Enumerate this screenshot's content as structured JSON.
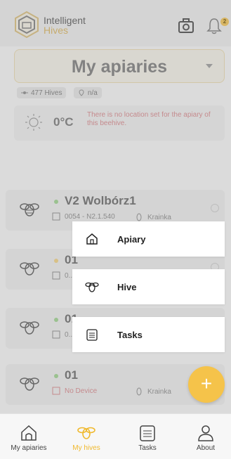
{
  "header": {
    "brand_line1": "Intelligent",
    "brand_line2": "Hives",
    "notification_count": "2"
  },
  "apiary_select": {
    "value": "My apiaries"
  },
  "stats": {
    "hives": "477 Hives",
    "location": "n/a"
  },
  "weather": {
    "temperature": "0°C",
    "message": "There is no location set for the apiary of this beehive."
  },
  "hives": [
    {
      "name": "V2 Wolbórz1",
      "device": "0054 - N2.1.540",
      "queen": "Krainka",
      "status": "green"
    },
    {
      "name": "01",
      "device": "0...",
      "queen": "",
      "status": "yellow"
    },
    {
      "name": "01",
      "device": "0...",
      "queen": "",
      "status": "green"
    },
    {
      "name": "01",
      "device": "No Device",
      "queen": "Krainka",
      "status": "green"
    }
  ],
  "menu": {
    "apiary": "Apiary",
    "hive": "Hive",
    "tasks": "Tasks"
  },
  "fab_label": "+",
  "nav": {
    "my_apiaries": "My apiaries",
    "my_hives": "My hives",
    "tasks": "Tasks",
    "about": "About"
  },
  "colors": {
    "accent": "#f5c34a",
    "warning_text": "#d7868a"
  },
  "icons": [
    "logo-icon",
    "camera-icon",
    "bell-icon",
    "drone-icon",
    "location-icon",
    "sun-icon",
    "bee-icon",
    "device-icon",
    "queen-icon",
    "info-icon",
    "home-icon",
    "tasks-icon",
    "person-icon"
  ]
}
